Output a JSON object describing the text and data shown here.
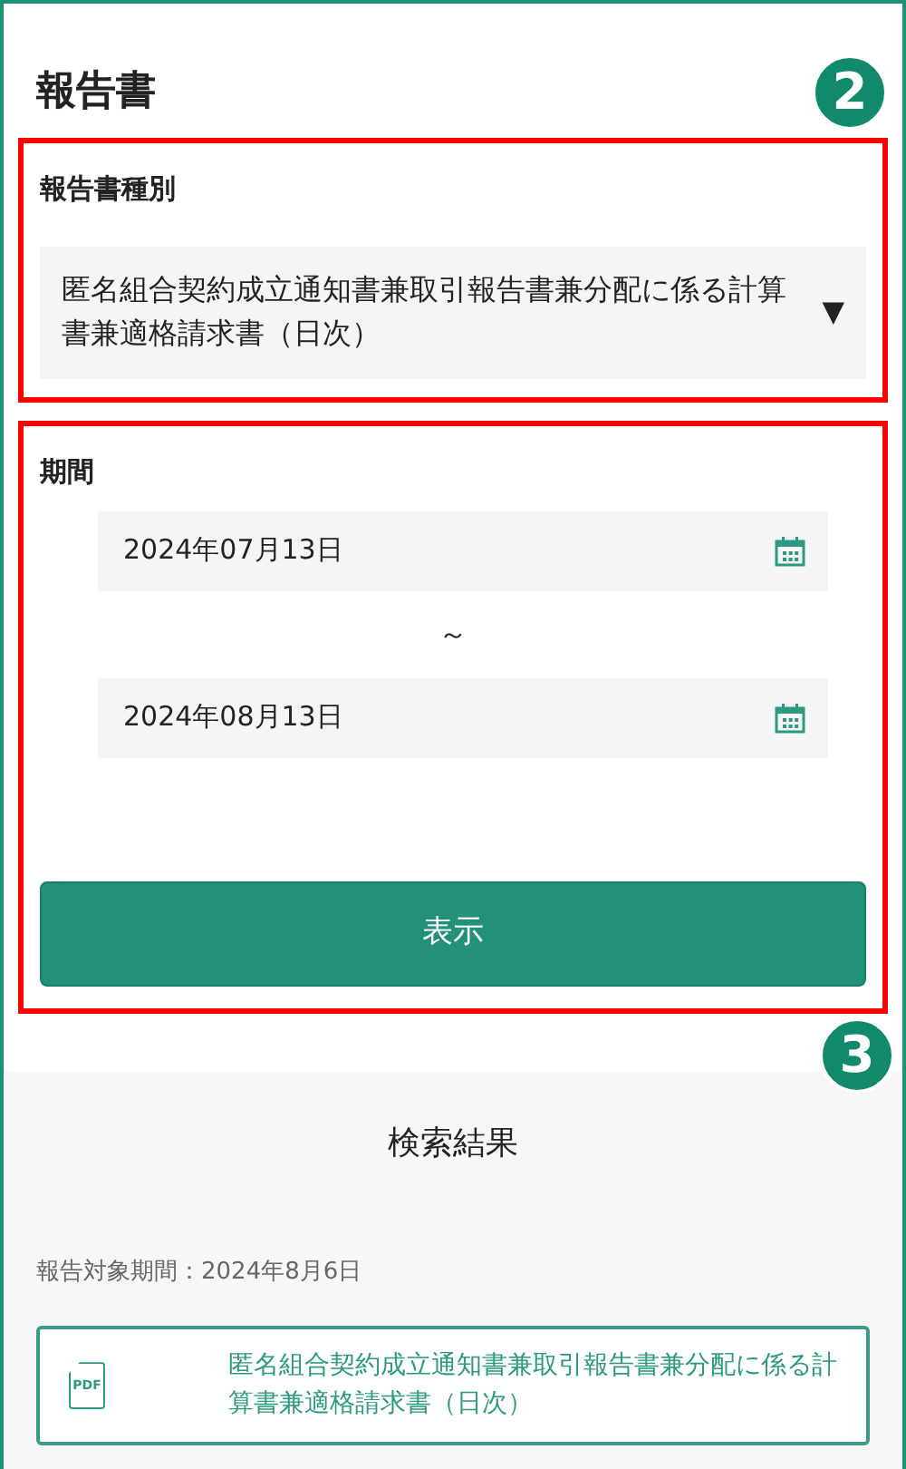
{
  "page_title": "報告書",
  "callouts": [
    {
      "number": "2"
    },
    {
      "number": "3"
    }
  ],
  "report_type": {
    "label": "報告書種別",
    "value": "匿名組合契約成立通知書兼取引報告書兼分配に係る計算書兼適格請求書（日次）",
    "arrow": "▼"
  },
  "period": {
    "label": "期間",
    "from": "2024年07月13日",
    "separator": "～",
    "to": "2024年08月13日"
  },
  "show_button": "表示",
  "results": {
    "title": "検索結果",
    "period_text": "報告対象期間：2024年8月6日",
    "documents": [
      {
        "icon_text": "PDF",
        "title": "匿名組合契約成立通知書兼取引報告書兼分配に係る計算書兼適格請求書（日次）"
      }
    ]
  }
}
